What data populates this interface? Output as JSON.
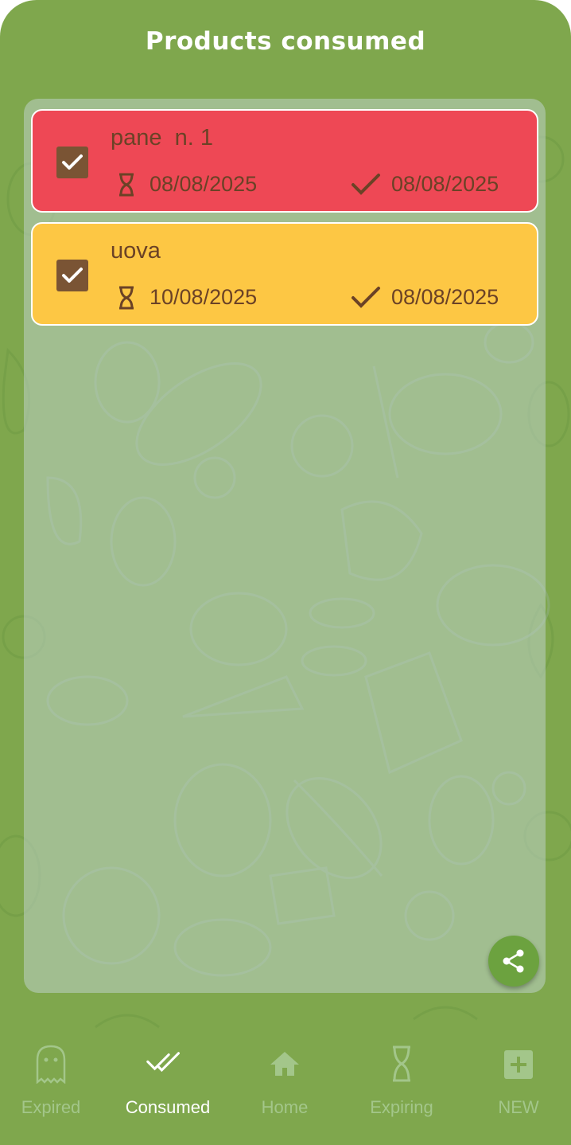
{
  "header": {
    "title": "Products consumed"
  },
  "products": [
    {
      "name": "pane  n. 1",
      "checked": true,
      "expiry_date": "08/08/2025",
      "consumed_date": "08/08/2025",
      "status_color": "#ee4855"
    },
    {
      "name": "uova",
      "checked": true,
      "expiry_date": "10/08/2025",
      "consumed_date": "08/08/2025",
      "status_color": "#fdc744"
    }
  ],
  "fab": {
    "icon": "share-icon"
  },
  "bottom_nav": {
    "items": [
      {
        "label": "Expired",
        "icon": "ghost-icon",
        "active": false
      },
      {
        "label": "Consumed",
        "icon": "double-check-icon",
        "active": true
      },
      {
        "label": "Home",
        "icon": "home-icon",
        "active": false
      },
      {
        "label": "Expiring",
        "icon": "hourglass-icon",
        "active": false
      },
      {
        "label": "NEW",
        "icon": "plus-square-icon",
        "active": false
      }
    ]
  },
  "colors": {
    "background": "#7fa74d",
    "text_brown": "#6b4226",
    "checkbox_brown": "#7a5434",
    "nav_inactive": "#a3c68a",
    "nav_active": "#ffffff"
  }
}
